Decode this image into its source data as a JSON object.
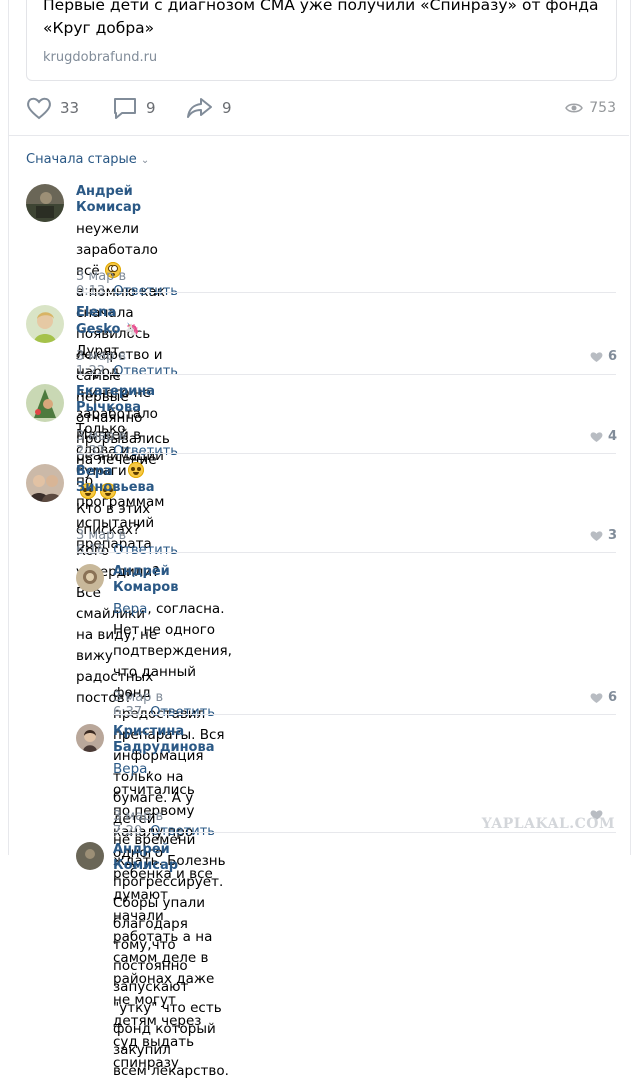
{
  "post": {
    "snippet_title": "Первые дети с диагнозом СМА уже получили «Спинразу» от фонда «Круг добра»",
    "snippet_domain": "krugdobrafund.ru",
    "likes": "33",
    "comments": "9",
    "shares": "9",
    "views": "753"
  },
  "sort_label": "Сначала старые",
  "reply_label": "Ответить",
  "comments": [
    {
      "author": "Андрей Комисар",
      "line1": "неужели заработало всё",
      "emoji": "flushed-face",
      "line2": "а помню как сначала появилось лекарство и самые первые отчаянно",
      "line3": "прорывались на лечение по программам испытаний препарата",
      "date": "3 мар в 0:13",
      "likes": ""
    },
    {
      "author": "Elena Gesko",
      "badge": "unicorn-icon",
      "line1": "Дурят народ ,ничего не заработало Матвей в реанимации",
      "date": "3 мар в 1:22",
      "likes": "6"
    },
    {
      "author": "Екатерина Рычкова",
      "line1": "Только слова и бумаги",
      "emoji": "grimacing-face",
      "date": "3 мар в 2:32",
      "likes": "4"
    },
    {
      "author": "Вера Зиновьева",
      "line1": "Кто в этих списках? Кого утвердили? Все смайлики на виду, не вижу",
      "line2": "радостных постов?",
      "date": "3 мар в 6:16",
      "likes": "3"
    }
  ],
  "replies": [
    {
      "author": "Андрей Комаров",
      "reply_to": "Вера",
      "line1": ", согласна. Нет не одного подтверждения, что данный фонд",
      "line2": "предоставил препараты. Вся информация только на бумаге. А у детей",
      "line3": "не времени ждать. Болезнь прогрессирует. Сборы упали благодаря",
      "line4": "тому,что постоянно запускают \"утку\" что есть фонд который закупил",
      "line5": "всем лекарство.",
      "date": "3 мар в 6:37",
      "likes": "6"
    },
    {
      "author": "Кристина Бадрудинова",
      "reply_to": "Вера",
      "line1": ", отчитались по первому каналу про одного ребёнка и все",
      "line2": "думают начали работать а на самом деле в районах даже не могут",
      "line3": "детям через суд выдать спинразу",
      "date": "3 мар в 7:20",
      "likes": ""
    },
    {
      "author": "Андрей Комисар"
    }
  ],
  "watermark": "YAPLAKAL.COM"
}
